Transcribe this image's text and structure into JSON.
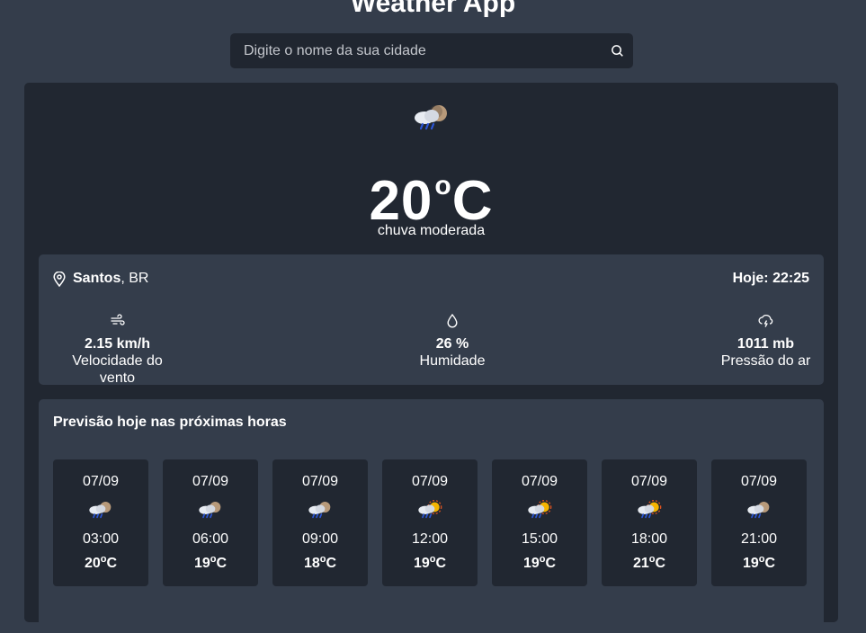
{
  "app": {
    "title": "Weather App"
  },
  "search": {
    "placeholder": "Digite o nome da sua cidade",
    "value": "",
    "icon": "search-icon"
  },
  "current": {
    "icon": "rain-cloud-moon-icon",
    "temperature": "20",
    "unit": "C",
    "condition": "chuva moderada",
    "city": "Santos",
    "country": ", BR",
    "today_label": "Hoje: 22:25",
    "wind": {
      "icon": "wind-icon",
      "value": "2.15 km/h",
      "label": "Velocidade do vento"
    },
    "humidity": {
      "icon": "droplet-icon",
      "value": "26 %",
      "label": "Humidade"
    },
    "pressure": {
      "icon": "cloud-lightning-icon",
      "value": "1011 mb",
      "label": "Pressão do ar"
    }
  },
  "forecast": {
    "title": "Previsão hoje nas próximas horas",
    "hours": [
      {
        "date": "07/09",
        "time": "03:00",
        "temp": "20",
        "unit": "C",
        "icon": "rain-cloud-moon-icon"
      },
      {
        "date": "07/09",
        "time": "06:00",
        "temp": "19",
        "unit": "C",
        "icon": "rain-cloud-moon-icon"
      },
      {
        "date": "07/09",
        "time": "09:00",
        "temp": "18",
        "unit": "C",
        "icon": "rain-cloud-moon-icon"
      },
      {
        "date": "07/09",
        "time": "12:00",
        "temp": "19",
        "unit": "C",
        "icon": "rain-cloud-sun-icon"
      },
      {
        "date": "07/09",
        "time": "15:00",
        "temp": "19",
        "unit": "C",
        "icon": "rain-cloud-sun-icon"
      },
      {
        "date": "07/09",
        "time": "18:00",
        "temp": "21",
        "unit": "C",
        "icon": "rain-cloud-sun-icon"
      },
      {
        "date": "07/09",
        "time": "21:00",
        "temp": "19",
        "unit": "C",
        "icon": "rain-cloud-moon-icon"
      }
    ]
  },
  "colors": {
    "page_bg": "#343d4b",
    "card_bg": "#212731",
    "text": "#ffffff"
  }
}
